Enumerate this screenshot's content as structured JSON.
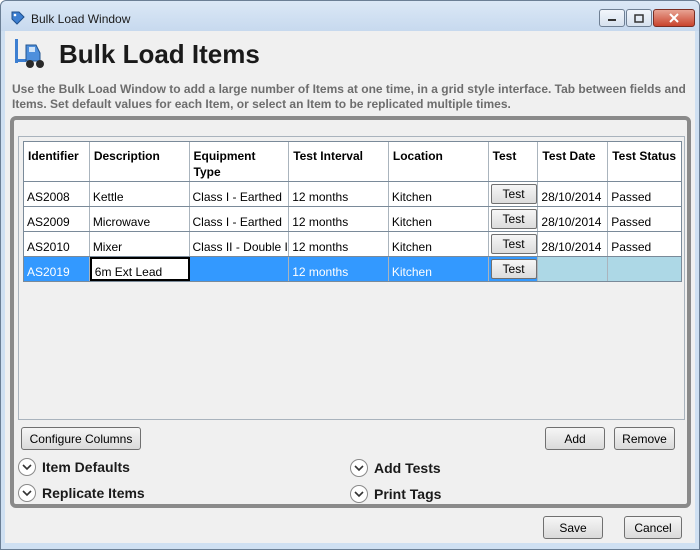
{
  "window": {
    "title": "Bulk Load Window",
    "icons": {
      "app": "tag-icon",
      "header": "forklift-icon"
    }
  },
  "header": {
    "title": "Bulk Load Items",
    "description": "Use the Bulk Load Window to add a large number of Items at one time, in a grid style interface. Tab between fields and Items. Set default values for each Item, or select an Item to be replicated multiple times."
  },
  "grid": {
    "columns": [
      "Identifier",
      "Description",
      "Equipment Type",
      "Test Interval",
      "Location",
      "Test",
      "Test Date",
      "Test Status"
    ],
    "rows": [
      {
        "identifier": "AS2008",
        "description": "Kettle",
        "equipment_type": "Class I - Earthed",
        "interval": "12 months",
        "location": "Kitchen",
        "test": "Test",
        "date": "28/10/2014",
        "status": "Passed"
      },
      {
        "identifier": "AS2009",
        "description": "Microwave",
        "equipment_type": "Class I - Earthed",
        "interval": "12 months",
        "location": "Kitchen",
        "test": "Test",
        "date": "28/10/2014",
        "status": "Passed"
      },
      {
        "identifier": "AS2010",
        "description": "Mixer",
        "equipment_type": "Class II - Double Insulated",
        "interval": "12 months",
        "location": "Kitchen",
        "test": "Test",
        "date": "28/10/2014",
        "status": "Passed"
      },
      {
        "identifier": "AS2019",
        "description": "6m Ext Lead",
        "equipment_type": "",
        "interval": "12 months",
        "location": "Kitchen",
        "test": "Test",
        "date": "",
        "status": ""
      }
    ]
  },
  "buttons": {
    "configure_columns": "Configure Columns",
    "add": "Add",
    "remove": "Remove",
    "save": "Save",
    "cancel": "Cancel"
  },
  "sections": {
    "item_defaults": "Item Defaults",
    "replicate_items": "Replicate Items",
    "add_tests": "Add Tests",
    "print_tags": "Print Tags"
  },
  "colors": {
    "selected_row": "#3399ff",
    "selected_blank": "#add8e6"
  }
}
